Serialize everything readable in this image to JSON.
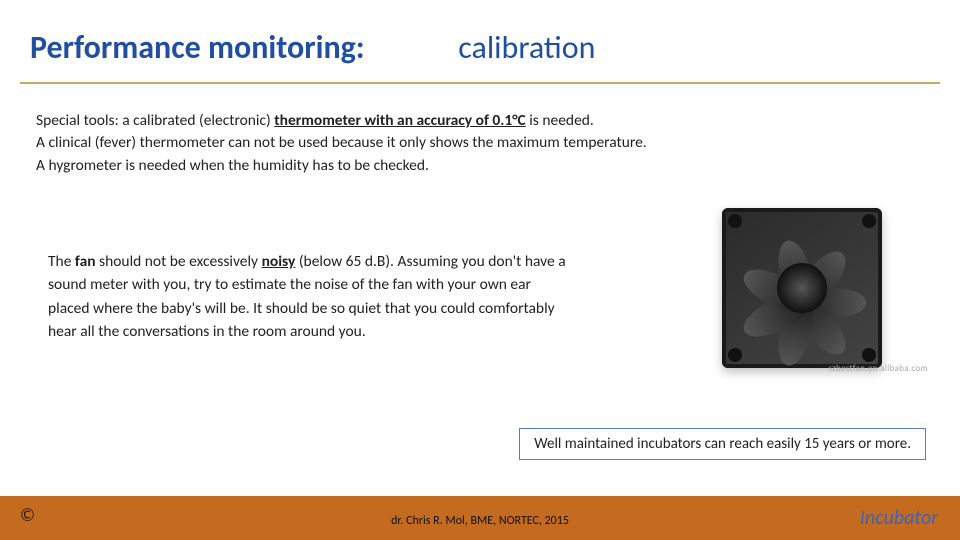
{
  "title": {
    "left": "Performance monitoring:",
    "right": "calibration"
  },
  "body1": {
    "lead": "Special tools: a calibrated (electronic) ",
    "bold_span": "thermometer with an accuracy of 0.1°C",
    "after": " is needed.",
    "line2": "A clinical (fever) thermometer can not be used because it only shows the maximum temperature.",
    "line3": "A hygrometer is needed when the humidity has to be checked."
  },
  "body2": {
    "pre": "The ",
    "fan": "fan",
    "mid1": " should not be excessively ",
    "noisy": "noisy",
    "rest": " (below 65 d.B). Assuming you don't have a sound meter with you, try to estimate the noise of the fan with your own ear placed where the baby's will be. It should be so quiet that you could comfortably hear all the conversations in the room around you."
  },
  "fan_watermark": "szbestfan.en.alibaba.com",
  "callout": "Well maintained incubators can reach easily 15 years or more.",
  "copyright": "©",
  "footer": {
    "credit": "dr. Chris R. Mol, BME, NORTEC, 2015",
    "brand": "Incubator"
  }
}
